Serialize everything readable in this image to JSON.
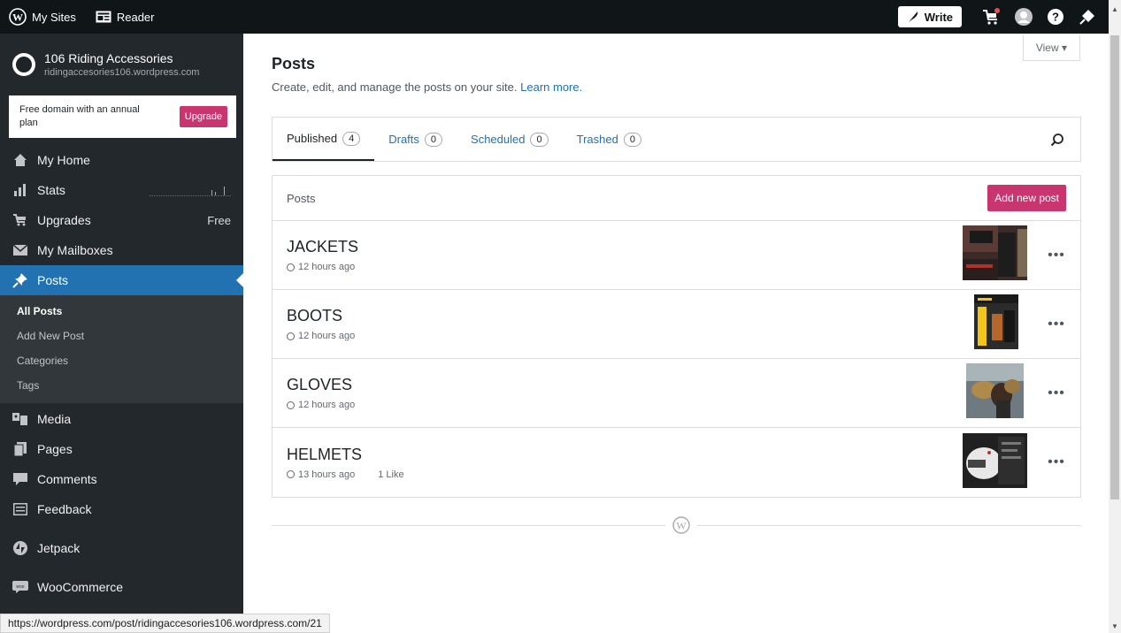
{
  "topbar": {
    "my_sites": "My Sites",
    "reader": "Reader",
    "write": "Write"
  },
  "site": {
    "name": "106 Riding Accessories",
    "url": "ridingaccesories106.wordpress.com"
  },
  "upsell": {
    "text": "Free domain with an annual plan",
    "button": "Upgrade"
  },
  "nav": {
    "my_home": "My Home",
    "stats": "Stats",
    "upgrades": "Upgrades",
    "upgrades_extra": "Free",
    "mailboxes": "My Mailboxes",
    "posts": "Posts",
    "media": "Media",
    "pages": "Pages",
    "comments": "Comments",
    "feedback": "Feedback",
    "jetpack": "Jetpack",
    "woocommerce": "WooCommerce"
  },
  "subnav": {
    "all_posts": "All Posts",
    "add_new": "Add New Post",
    "categories": "Categories",
    "tags": "Tags"
  },
  "main": {
    "view": "View",
    "title": "Posts",
    "subtitle": "Create, edit, and manage the posts on your site.",
    "learn_more": "Learn more."
  },
  "tabs": [
    {
      "label": "Published",
      "count": "4"
    },
    {
      "label": "Drafts",
      "count": "0"
    },
    {
      "label": "Scheduled",
      "count": "0"
    },
    {
      "label": "Trashed",
      "count": "0"
    }
  ],
  "posts_list": {
    "header": "Posts",
    "add_button": "Add new post",
    "rows": [
      {
        "title": "JACKETS",
        "time": "12 hours ago",
        "likes": ""
      },
      {
        "title": "BOOTS",
        "time": "12 hours ago",
        "likes": ""
      },
      {
        "title": "GLOVES",
        "time": "12 hours ago",
        "likes": ""
      },
      {
        "title": "HELMETS",
        "time": "13 hours ago",
        "likes": "1 Like"
      }
    ]
  },
  "statusbar": {
    "url": "https://wordpress.com/post/ridingaccesories106.wordpress.com/21"
  },
  "colors": {
    "accent": "#2271b1",
    "brand_pink": "#c9356e",
    "sidebar_bg": "#23282d",
    "topbar_bg": "#101517"
  }
}
